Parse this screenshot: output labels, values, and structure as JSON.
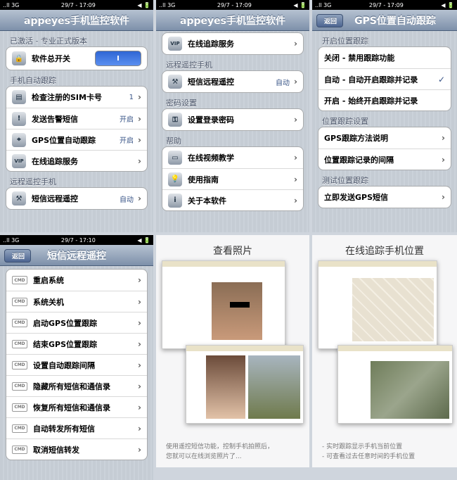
{
  "status_bars": [
    {
      "carrier": "..ll 3G",
      "time": "29/7 - 17:09",
      "battery": "◀ 🔋"
    },
    {
      "carrier": "..ll 3G",
      "time": "29/7 - 17:09",
      "battery": "◀ 🔋"
    },
    {
      "carrier": "..ll 3G",
      "time": "29/7 - 17:09",
      "battery": "◀ 🔋"
    },
    {
      "carrier": "..ll 3G",
      "time": "29/7 - 17:10",
      "battery": "◀ 🔋"
    }
  ],
  "panel1": {
    "title": "appeyes手机监控软件",
    "sec1": "已激活 - 专业正式版本",
    "master": {
      "label": "软件总开关",
      "toggle": "I"
    },
    "sec2": "手机自动跟踪",
    "items": [
      {
        "label": "检查注册的SIM卡号",
        "value": "1"
      },
      {
        "label": "发送告警短信",
        "value": "开启"
      },
      {
        "label": "GPS位置自动跟踪",
        "value": "开启"
      },
      {
        "label": "在线追踪服务",
        "value": ""
      }
    ],
    "sec3": "远程遥控手机",
    "remote": {
      "label": "短信远程遥控",
      "value": "自动"
    }
  },
  "panel2": {
    "title": "appeyes手机监控软件",
    "track": {
      "label": "在线追踪服务"
    },
    "sec1": "远程遥控手机",
    "remote": {
      "label": "短信远程遥控",
      "value": "自动"
    },
    "sec2": "密码设置",
    "password": {
      "label": "设置登录密码"
    },
    "sec3": "帮助",
    "help": [
      {
        "label": "在线视频教学"
      },
      {
        "label": "使用指南"
      },
      {
        "label": "关于本软件"
      }
    ]
  },
  "panel3": {
    "back": "返回",
    "title": "GPS位置自动跟踪",
    "sec1": "开启位置跟踪",
    "options": [
      {
        "label": "关闭 - 禁用跟踪功能",
        "checked": ""
      },
      {
        "label": "自动 - 自动开启跟踪并记录",
        "checked": "✓"
      },
      {
        "label": "开启 - 始终开启跟踪并记录",
        "checked": ""
      }
    ],
    "sec2": "位置跟踪设置",
    "settings": [
      {
        "label": "GPS跟踪方法说明"
      },
      {
        "label": "位置跟踪记录的间隔"
      }
    ],
    "sec3": "测试位置跟踪",
    "test": {
      "label": "立即发送GPS短信"
    }
  },
  "panel4": {
    "back": "返回",
    "title": "短信远程遥控",
    "cmd_tag": "CMD",
    "commands": [
      "重启系统",
      "系统关机",
      "启动GPS位置跟踪",
      "结束GPS位置跟踪",
      "设置自动跟踪间隔",
      "隐藏所有短信和通信录",
      "恢复所有短信和通信录",
      "自动转发所有短信",
      "取消短信转发"
    ]
  },
  "promo1": {
    "title": "查看照片",
    "caption_line1": "使用遥控短信功能，控制手机拍照后，",
    "caption_line2": "您就可以在线浏览照片了..."
  },
  "promo2": {
    "title": "在线追踪手机位置",
    "caption_line1": "- 实时跟踪显示手机当前位置",
    "caption_line2": "- 可查看过去任意时间的手机位置"
  },
  "chevron": "›"
}
